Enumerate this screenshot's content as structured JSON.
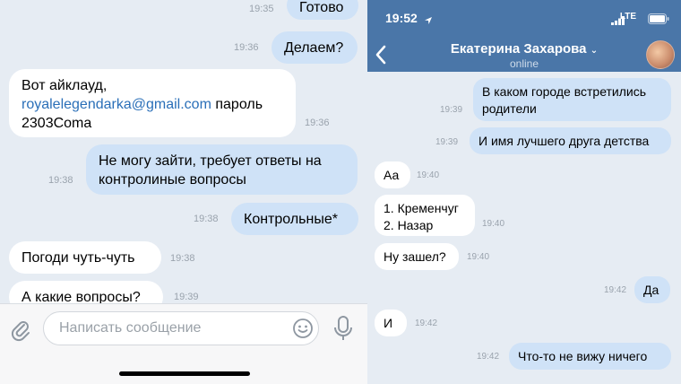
{
  "left": {
    "messages": [
      {
        "text": "Готово",
        "time": "19:35"
      },
      {
        "text": "Делаем?",
        "time": "19:36"
      },
      {
        "line1": "Вот айклауд,",
        "email": "royalelegendarka@gmail.com",
        "password_label": " пароль",
        "line3": "2303Coma",
        "time": "19:36"
      },
      {
        "line1": "Не могу зайти, требует ответы на",
        "line2": "контролиные вопросы",
        "time": "19:38"
      },
      {
        "text": "Контрольные*",
        "time": "19:38"
      },
      {
        "text": "Погоди чуть-чуть",
        "time": "19:38"
      },
      {
        "text": "А какие вопросы?",
        "time": "19:39"
      }
    ],
    "composer": {
      "placeholder": "Написать сообщение"
    }
  },
  "right": {
    "status": {
      "time": "19:52",
      "network": "LTE"
    },
    "header": {
      "name": "Екатерина Захарова",
      "status": "online"
    },
    "messages": [
      {
        "line1": "В каком городе встретились",
        "line2": "родители",
        "time": "19:39"
      },
      {
        "text": "И имя лучшего друга детства",
        "time": "19:39"
      },
      {
        "text": "Аа",
        "time": "19:40"
      },
      {
        "line1": "1. Кременчуг",
        "line2": "2. Назар",
        "time": "19:40"
      },
      {
        "text": "Ну зашел?",
        "time": "19:40"
      },
      {
        "text": "Да",
        "time": "19:42"
      },
      {
        "text": "И",
        "time": "19:42"
      },
      {
        "text": "Что-то не вижу ничего",
        "time": "19:42"
      }
    ]
  }
}
